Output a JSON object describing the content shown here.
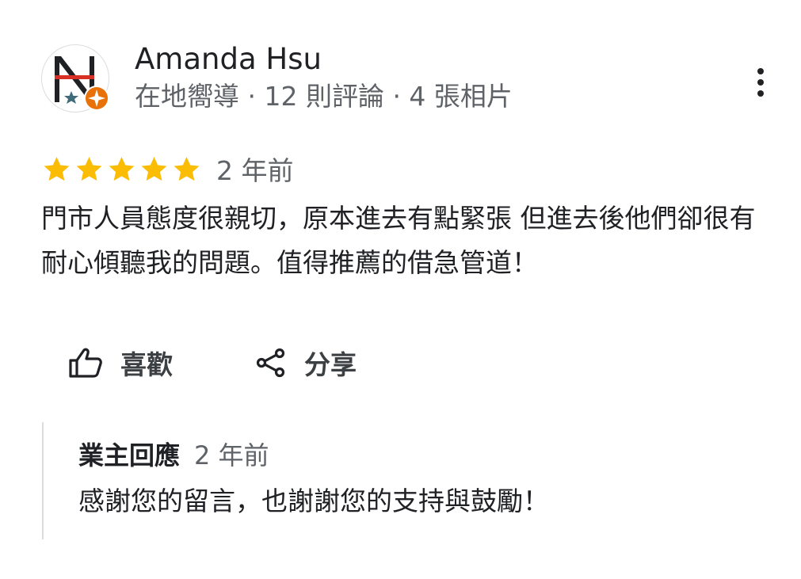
{
  "reviewer": {
    "name": "Amanda Hsu",
    "meta": "在地嚮導 · 12 則評論 · 4 張相片"
  },
  "review": {
    "rating": 5,
    "max_rating": 5,
    "date": "2 年前",
    "text": "門市人員態度很親切，原本進去有點緊張 但進去後他們卻很有耐心傾聽我的問題。值得推薦的借急管道！"
  },
  "actions": {
    "like_label": "喜歡",
    "share_label": "分享"
  },
  "owner_reply": {
    "title": "業主回應",
    "date": "2 年前",
    "text": "感謝您的留言，也謝謝您的支持與鼓勵！"
  },
  "colors": {
    "star": "#fbbc04",
    "text_primary": "#202124",
    "text_secondary": "#5f6368",
    "local_guide_badge": "#e8710a",
    "avatar_red": "#d93025",
    "avatar_star": "#3f6b7a"
  },
  "icons": {
    "more": "more-vert-icon",
    "like": "thumb-up-icon",
    "share": "share-icon",
    "star": "star-icon",
    "badge": "local-guide-badge-icon"
  }
}
